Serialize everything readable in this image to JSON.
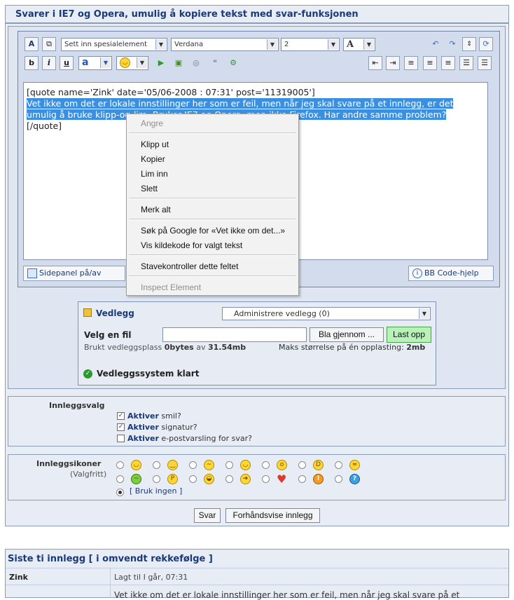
{
  "page_title": "Svarer i IE7 og Opera, umulig å kopiere tekst med svar-funksjonen",
  "toolbar": {
    "special_select": "Sett inn spesialelement",
    "font_select": "Verdana",
    "size_select": "2",
    "color_label": "A",
    "bold": "b",
    "italic": "i",
    "underline": "u",
    "font_color": "a"
  },
  "editor": {
    "quote_open": "[quote name='Zink' date='05/06-2008 : 07:31' post='11319005']",
    "selected_line1": "Vet ikke om det er lokale innstillinger her som er feil, men når jeg skal svare på et innlegg, er det",
    "selected_line2": "umulig å bruke klipp-og-lim. Bruker IE7 og Opera, men ikke Firefox. Har andre samme problem?",
    "quote_close": "[/quote]"
  },
  "side_panel_button": "Sidepanel på/av",
  "bbcode_help_button": "BB Code-hjelp",
  "context_menu": {
    "undo": "Angre",
    "cut": "Klipp ut",
    "copy": "Kopier",
    "paste": "Lim inn",
    "delete": "Slett",
    "select_all": "Merk alt",
    "search_google": "Søk på Google for «Vet ikke om det...»",
    "view_source": "Vis kildekode for valgt tekst",
    "spellcheck": "Stavekontroller dette feltet",
    "inspect": "Inspect Element"
  },
  "attachments": {
    "title": "Vedlegg",
    "manage_select": "Administrere vedlegg (0)",
    "choose_file_label": "Velg en fil",
    "browse_button": "Bla gjennom ...",
    "upload_button": "Last opp",
    "used_prefix": "Brukt vedleggsplass",
    "used_value": "0bytes",
    "used_of": "av",
    "used_total": "31.54mb",
    "max_label": "Maks størrelse på én opplasting:",
    "max_value": "2mb",
    "status": "Vedleggssystem klart"
  },
  "post_options": {
    "label": "Innleggsvalg",
    "items": [
      {
        "bold": "Aktiver",
        "text": "smil?",
        "checked": true
      },
      {
        "bold": "Aktiver",
        "text": "signatur?",
        "checked": true
      },
      {
        "bold": "Aktiver",
        "text": "e-postvarsling for svar?",
        "checked": false
      }
    ]
  },
  "post_icons": {
    "label": "Innleggsikoner",
    "sublabel": "(Valgfritt)",
    "none_label": "[ Bruk ingen ]"
  },
  "buttons": {
    "submit": "Svar",
    "preview": "Forhåndsvise innlegg"
  },
  "last_posts": {
    "title": "Siste ti innlegg [ i omvendt rekkefølge ]",
    "author": "Zink",
    "posted": "Lagt til I går, 07:31",
    "excerpt": "Vet ikke om det er lokale innstillinger her som er feil, men når jeg skal svare på et"
  }
}
